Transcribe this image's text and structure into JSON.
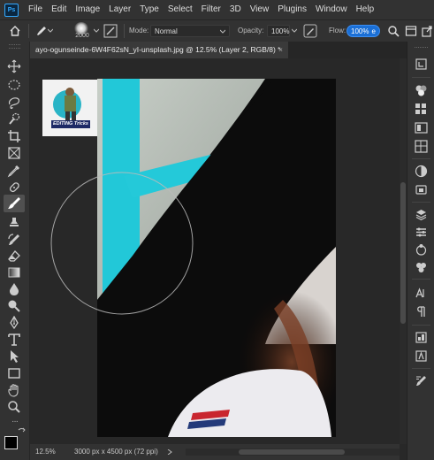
{
  "app": {
    "logo_text": "Ps"
  },
  "menu": [
    "File",
    "Edit",
    "Image",
    "Layer",
    "Type",
    "Select",
    "Filter",
    "3D",
    "View",
    "Plugins",
    "Window",
    "Help"
  ],
  "options": {
    "brush_size": "2000",
    "mode_label": "Mode:",
    "mode_value": "Normal",
    "opacity_label": "Opacity:",
    "opacity_value": "100%",
    "flow_label": "Flow:",
    "flow_value": "100%"
  },
  "document": {
    "tab_title": "ayo-ogunseinde-6W4F62sN_yI-unsplash.jpg @ 12.5% (Layer 2, RGB/8) *",
    "close_glyph": "×"
  },
  "watermark": {
    "caption": "EDITING Tricks"
  },
  "status": {
    "zoom": "12.5%",
    "doc_info": "3000 px x 4500 px (72 ppi)"
  },
  "colors": {
    "accent": "#31a8ff",
    "flow_highlight": "#1a6fd6",
    "foreground": "#000000",
    "background": "#ffffff"
  }
}
